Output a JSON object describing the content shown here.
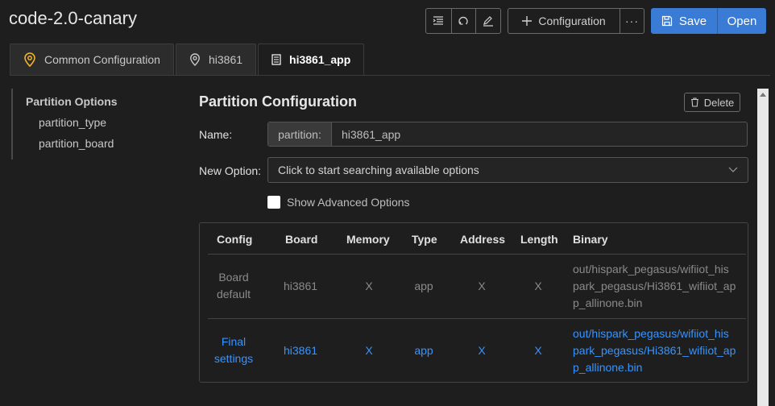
{
  "app_title": "code-2.0-canary",
  "toolbar": {
    "config_label": "Configuration",
    "more_label": "···",
    "save_label": "Save",
    "open_label": "Open"
  },
  "tabs": [
    {
      "label": "Common Configuration",
      "icon": "location-pin-icon"
    },
    {
      "label": "hi3861",
      "icon": "location-pin-icon"
    },
    {
      "label": "hi3861_app",
      "icon": "partition-icon"
    }
  ],
  "sidebar": {
    "heading": "Partition Options",
    "items": [
      "partition_type",
      "partition_board"
    ]
  },
  "main": {
    "title": "Partition Configuration",
    "delete_label": "Delete",
    "name_label": "Name:",
    "name_prefix": "partition:",
    "name_value": "hi3861_app",
    "new_option_label": "New Option:",
    "new_option_placeholder": "Click to start searching available options",
    "advanced_label": "Show Advanced Options"
  },
  "table": {
    "headers": [
      "Config",
      "Board",
      "Memory",
      "Type",
      "Address",
      "Length",
      "Binary"
    ],
    "rows": [
      {
        "config": [
          "Board",
          "default"
        ],
        "board": "hi3861",
        "memory": "X",
        "type": "app",
        "address": "X",
        "length": "X",
        "binary": [
          "out/hispark_pegasus/wifiiot_his",
          "park_pegasus/Hi3861_wifiiot_ap",
          "p_allinone.bin"
        ]
      },
      {
        "config": [
          "Final",
          "settings"
        ],
        "board": "hi3861",
        "memory": "X",
        "type": "app",
        "address": "X",
        "length": "X",
        "binary": [
          "out/hispark_pegasus/wifiiot_his",
          "park_pegasus/Hi3861_wifiiot_ap",
          "p_allinone.bin"
        ]
      }
    ]
  },
  "colors": {
    "accent": "#3a7bd5",
    "link": "#3794ff",
    "pin_icon": "#f0b429"
  }
}
